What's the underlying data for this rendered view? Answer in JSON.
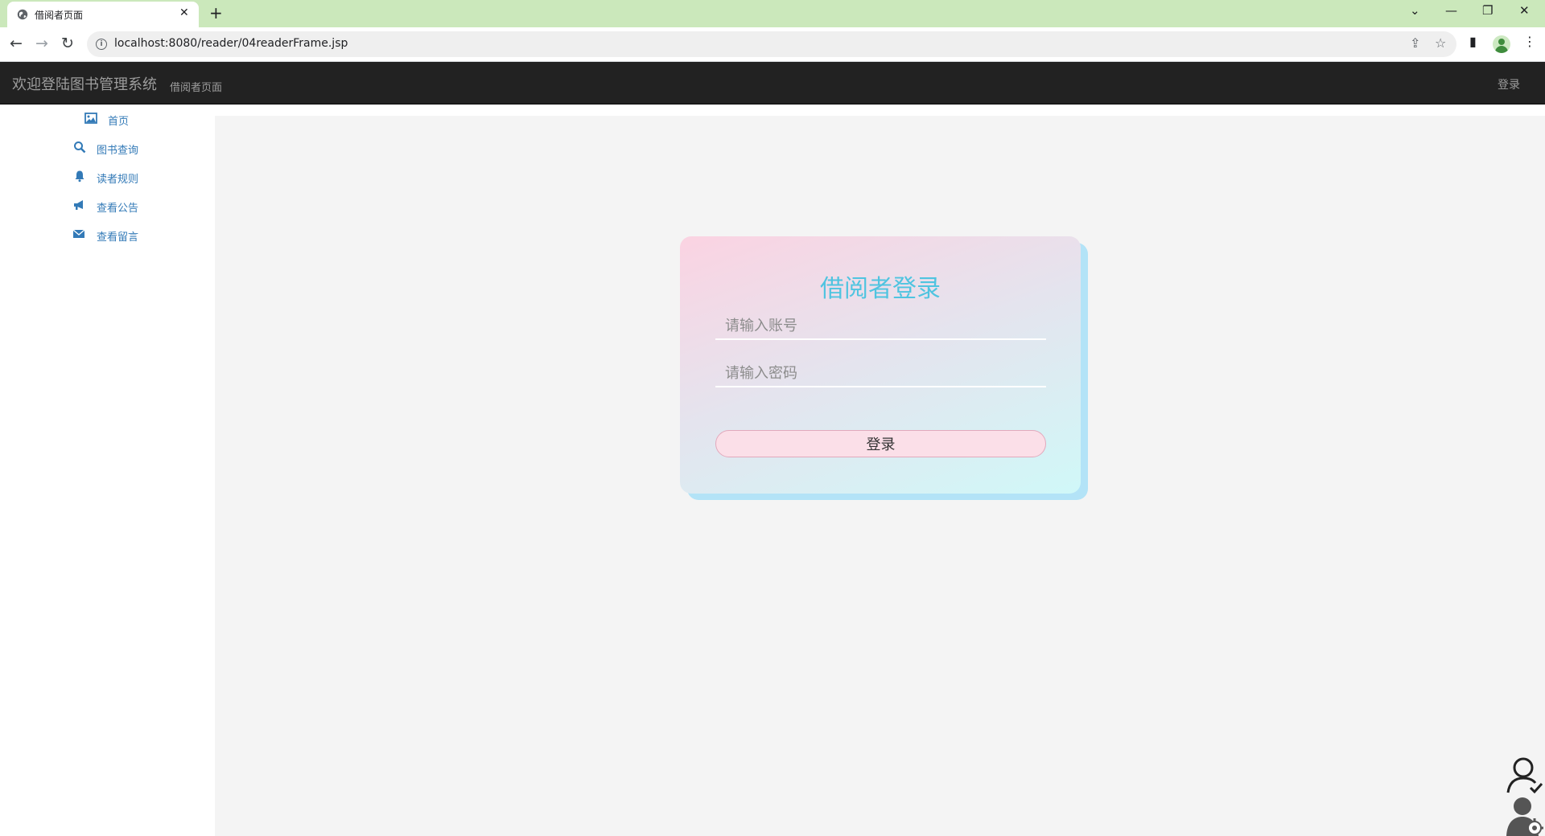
{
  "browser": {
    "tab_title": "借阅者页面",
    "tab_close": "✕",
    "new_tab": "+",
    "url": "localhost:8080/reader/04readerFrame.jsp",
    "window_controls": {
      "dropdown": "⌄",
      "minimize": "—",
      "restore": "❐",
      "close": "✕"
    },
    "nav": {
      "back": "←",
      "forward": "→",
      "reload": "↻"
    },
    "icons": {
      "share": "⇪",
      "bookmark": "☆",
      "sidepanel": "▮",
      "menu": "⋮",
      "info": "i"
    }
  },
  "navbar": {
    "brand": "欢迎登陆图书管理系统",
    "subtitle": "借阅者页面",
    "login_link": "登录"
  },
  "sidebar": {
    "items": [
      {
        "label": "首页",
        "icon": "picture-icon"
      },
      {
        "label": "图书查询",
        "icon": "search-icon"
      },
      {
        "label": "读者规则",
        "icon": "bell-icon"
      },
      {
        "label": "查看公告",
        "icon": "bullhorn-icon"
      },
      {
        "label": "查看留言",
        "icon": "envelope-icon"
      }
    ]
  },
  "login_card": {
    "title": "借阅者登录",
    "account_placeholder": "请输入账号",
    "password_placeholder": "请输入密码",
    "button_label": "登录"
  },
  "colors": {
    "navbar_bg": "#222222",
    "link": "#337ab7",
    "card_title": "#4fc4e0",
    "main_bg": "#f4f4f4",
    "tabstrip": "#cbe8bb"
  }
}
